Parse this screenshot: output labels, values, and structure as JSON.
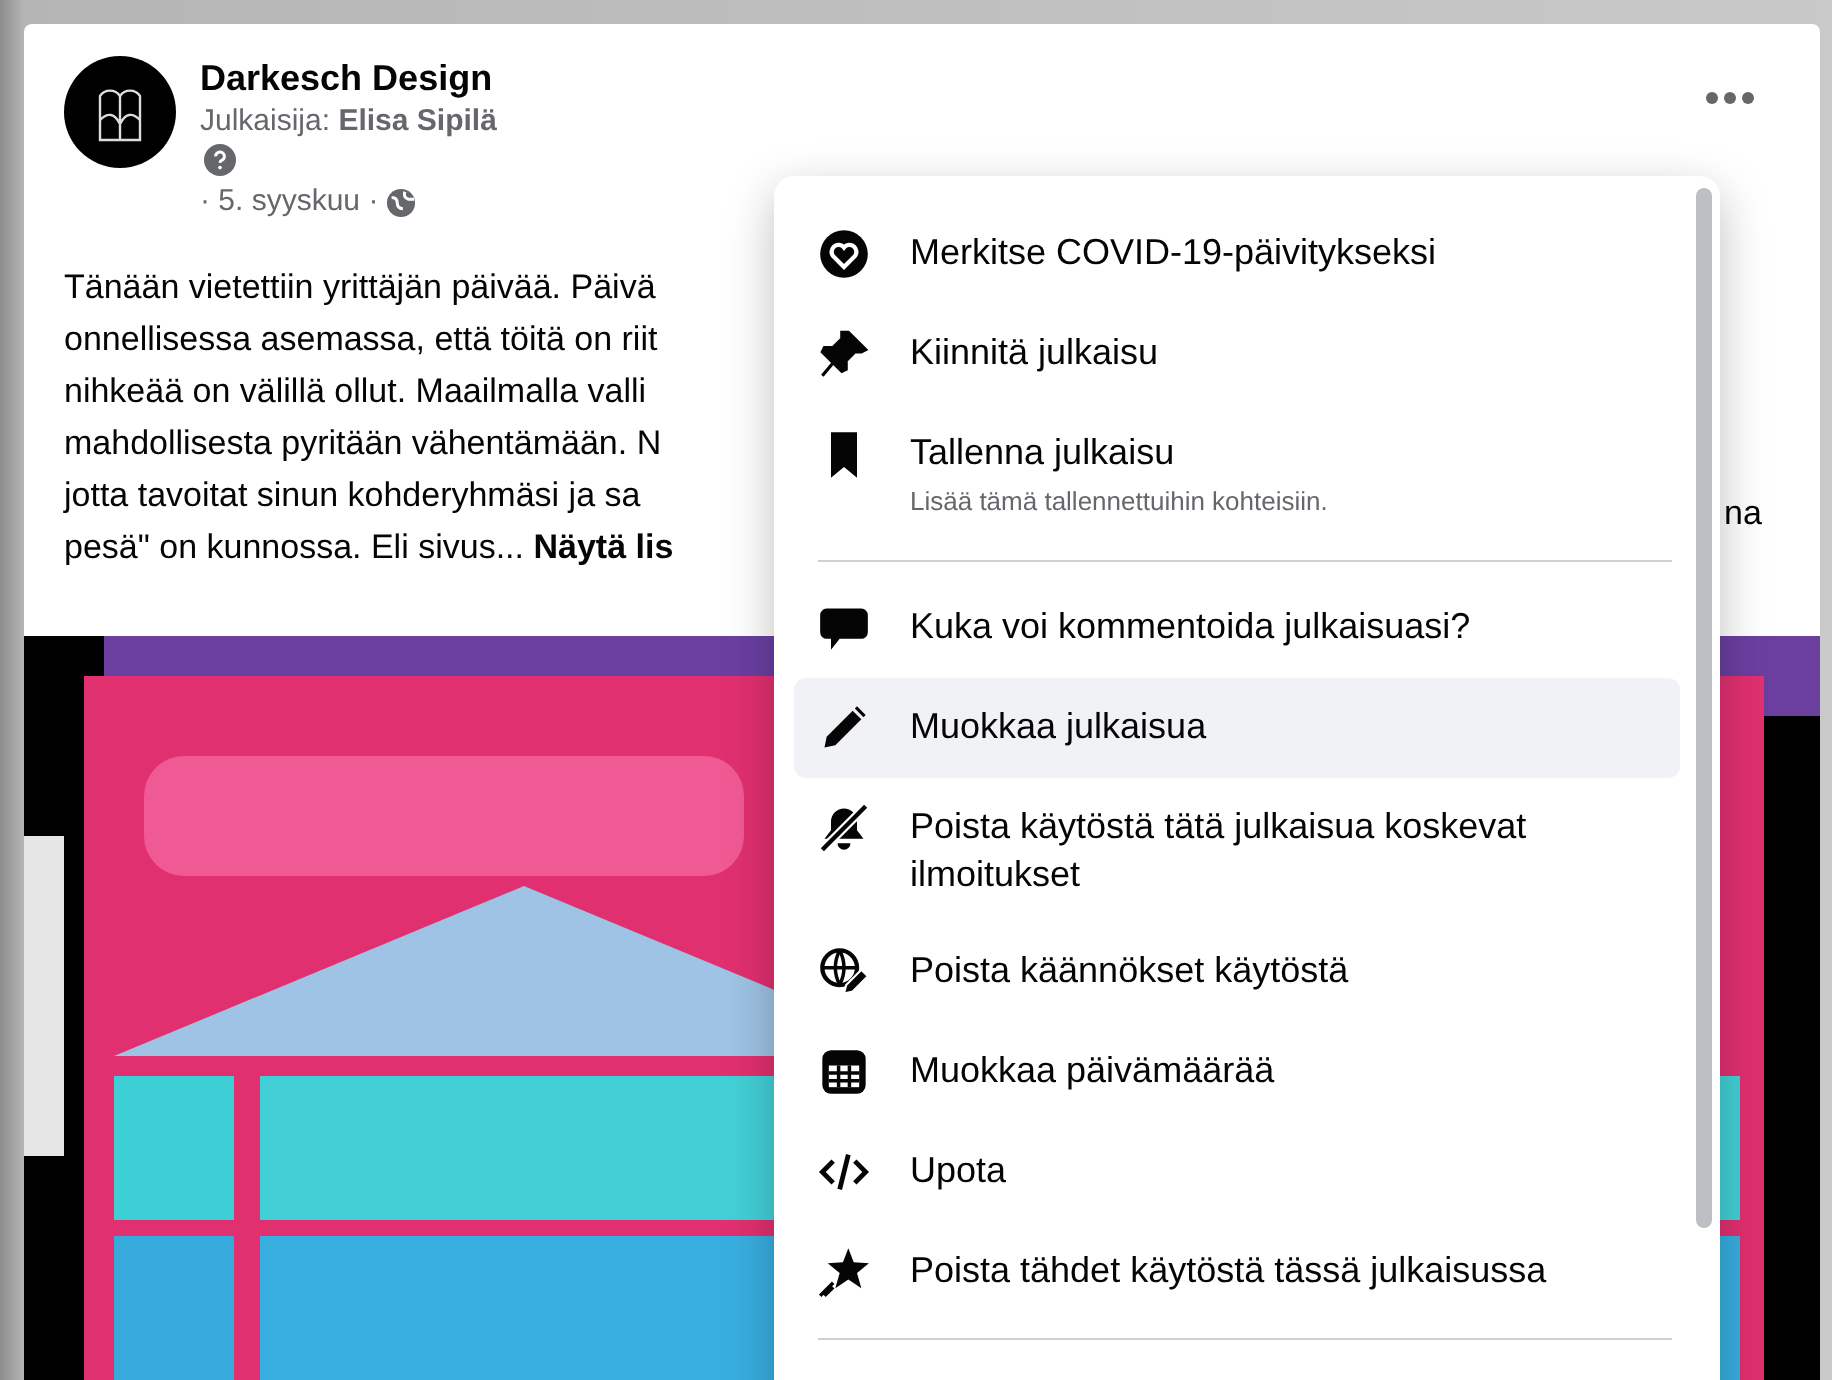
{
  "post": {
    "page_name": "Darkesch Design",
    "byline": "Julkaisija: **Elisa Sipilä**",
    "date": "· 5. syyskuu ·",
    "text_lines": [
      "Tänään vietettiin yrittäjän päivää. Päivä",
      "onnellisessa asemassa, että töitä on riit",
      "nihkeää on välillä ollut. Maailmalla valli",
      "mahdollisesta pyritään vähentämään. N",
      "jotta tavoitat sinun kohderyhmäsi ja sa",
      "pesä\" on kunnossa. Eli sivus..."
    ],
    "see_more": "Näytä lis",
    "overflow_text": "na",
    "image": {
      "kind": "picture"
    }
  },
  "menu": {
    "sections": [
      {
        "items": [
          {
            "label": "Merkitse COVID-19-päivitykseksi",
            "selected": false
          },
          {
            "label": "Kiinnitä julkaisu",
            "selected": false
          },
          {
            "label": "Tallenna julkaisu",
            "subtitle": "Lisää tämä tallennettuihin kohteisiin.",
            "selected": false
          }
        ]
      },
      {
        "items": [
          {
            "label": "Kuka voi kommentoida julkaisuasi?",
            "selected": false
          },
          {
            "label": "Muokkaa julkaisua",
            "selected": true
          },
          {
            "label": "Poista käytöstä tätä julkaisua koskevat ilmoitukset",
            "selected": false
          },
          {
            "label": "Poista käännökset käytöstä",
            "selected": false
          },
          {
            "label": "Muokkaa päivämäärää",
            "selected": false
          },
          {
            "label": "Upota",
            "selected": false
          },
          {
            "label": "Poista tähdet käytöstä tässä julkaisussa",
            "selected": false
          }
        ]
      }
    ]
  }
}
